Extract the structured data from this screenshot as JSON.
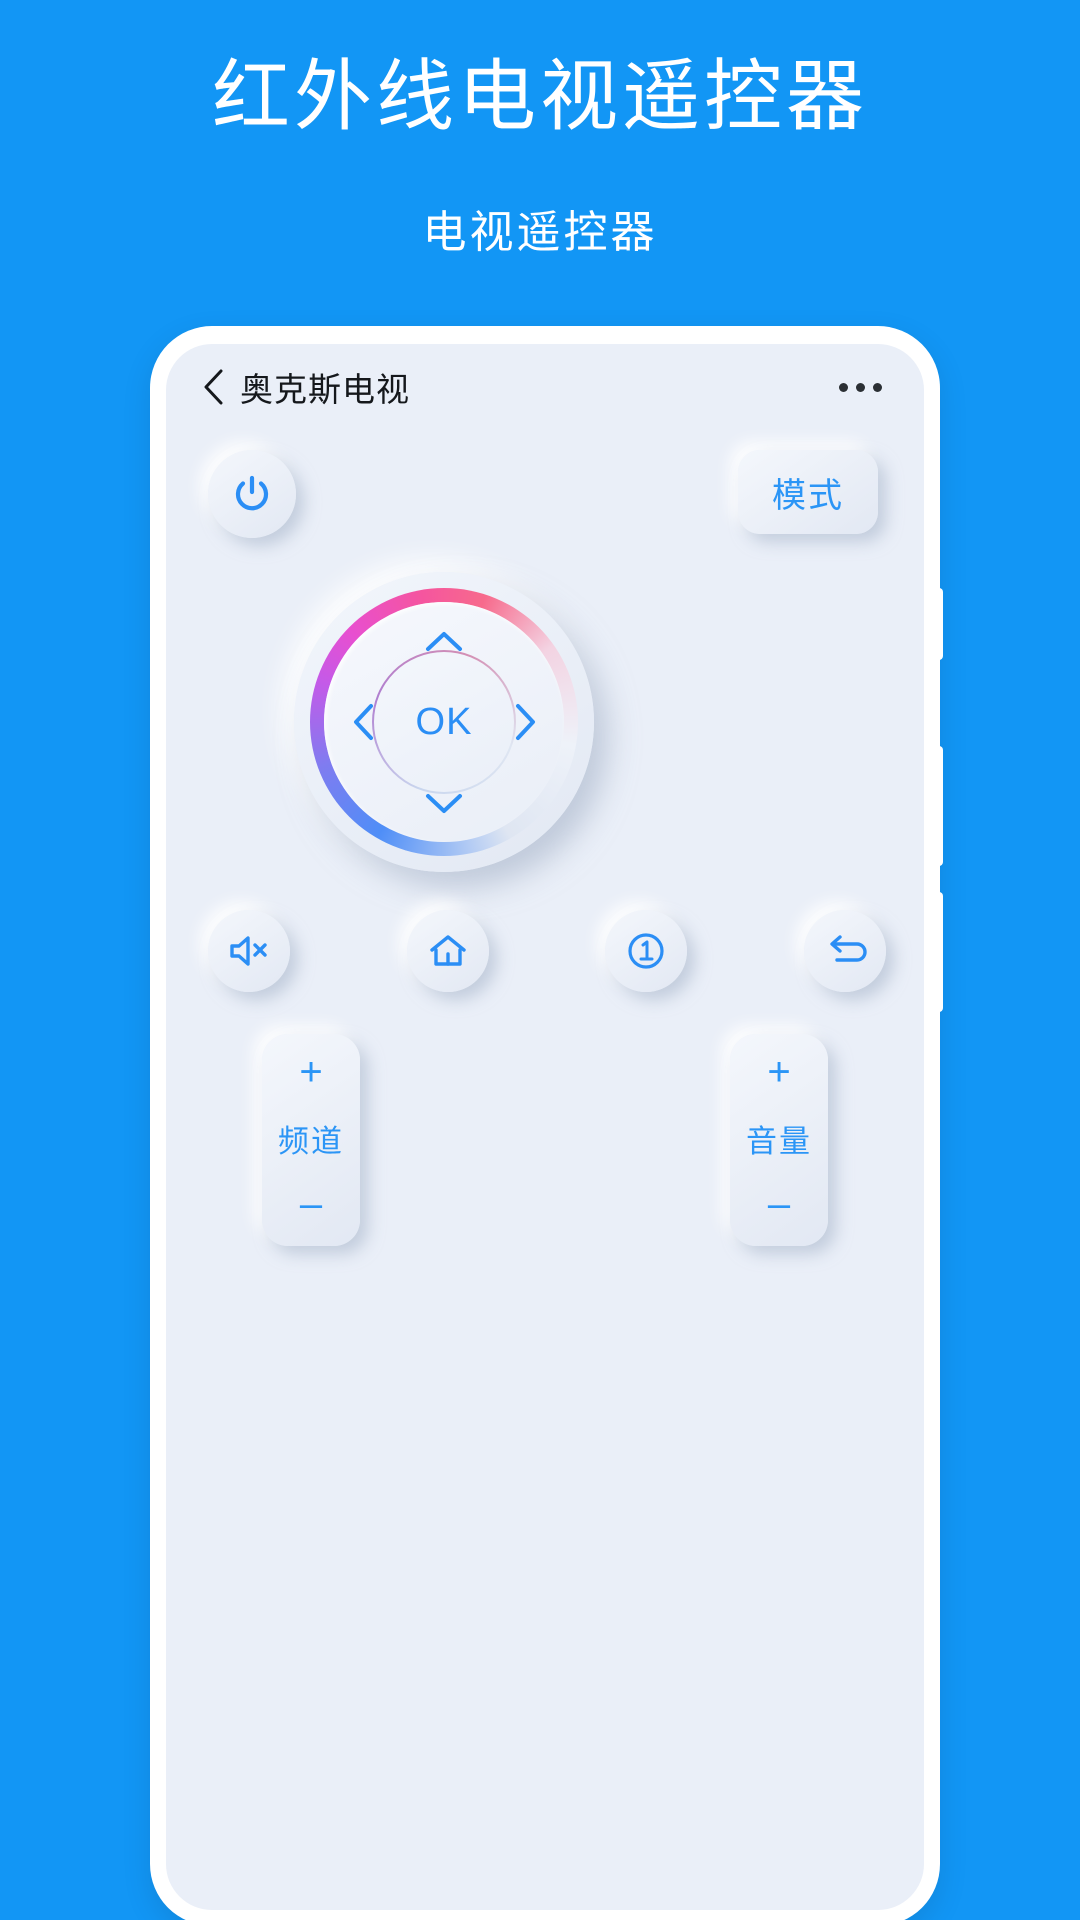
{
  "promo": {
    "title": "红外线电视遥控器",
    "subtitle": "电视遥控器"
  },
  "colors": {
    "background": "#1296f5",
    "screen": "#eaeff8",
    "accent": "#2b95f6",
    "title_text": "#ffffff",
    "header_text": "#15181c",
    "ring_pink": "#f5559f",
    "ring_blue": "#4f8ef7"
  },
  "app": {
    "header": {
      "back_icon": "chevron-left-icon",
      "title": "奥克斯电视",
      "menu_icon": "more-horizontal-icon"
    },
    "power_button": {
      "icon": "power-icon"
    },
    "mode_button": {
      "label": "模式"
    },
    "dpad": {
      "ok_label": "OK",
      "up_icon": "chevron-up-icon",
      "down_icon": "chevron-down-icon",
      "left_icon": "chevron-left-icon",
      "right_icon": "chevron-right-icon"
    },
    "function_buttons": [
      {
        "name": "mute",
        "icon": "volume-mute-icon"
      },
      {
        "name": "home",
        "icon": "home-icon"
      },
      {
        "name": "source",
        "icon": "circle-one-icon"
      },
      {
        "name": "back",
        "icon": "return-arrow-icon"
      }
    ],
    "rockers": [
      {
        "name": "channel",
        "plus": "+",
        "label": "频道",
        "minus": "–"
      },
      {
        "name": "volume",
        "plus": "+",
        "label": "音量",
        "minus": "–"
      }
    ]
  }
}
